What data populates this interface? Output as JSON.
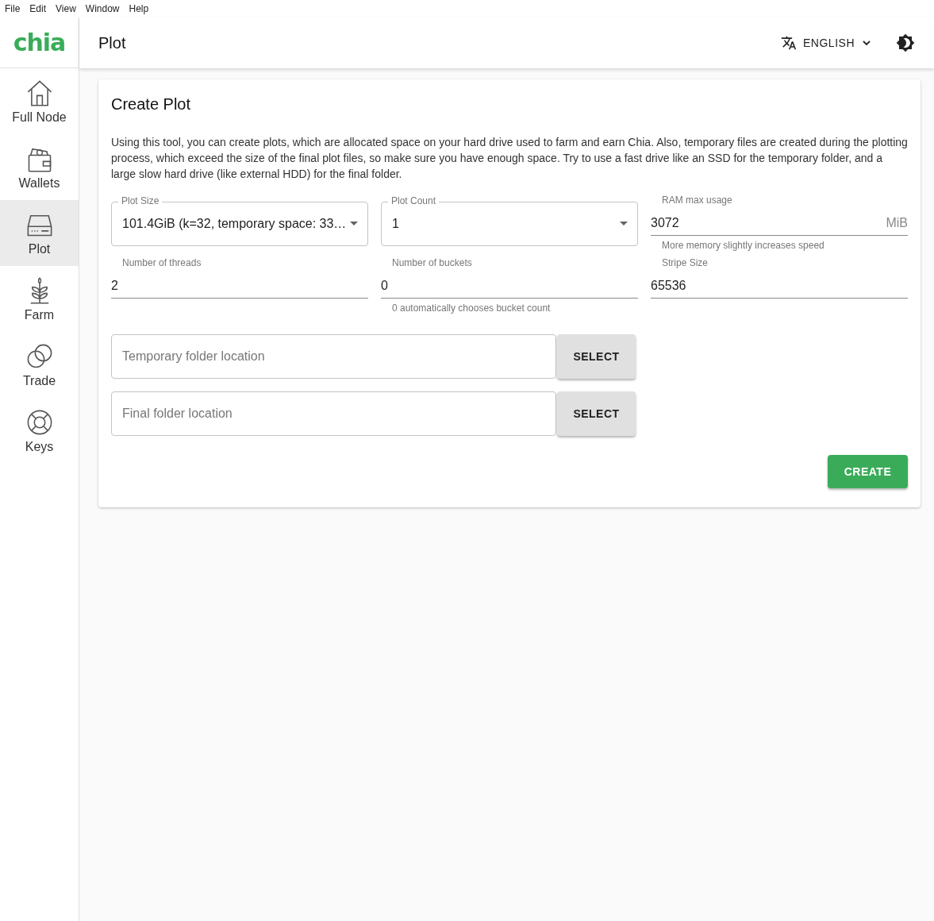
{
  "menu_bar": [
    "File",
    "Edit",
    "View",
    "Window",
    "Help"
  ],
  "logo": "chia",
  "header": {
    "title": "Plot",
    "language": "ENGLISH"
  },
  "sidebar": {
    "items": [
      {
        "label": "Full Node",
        "selected": false
      },
      {
        "label": "Wallets",
        "selected": false
      },
      {
        "label": "Plot",
        "selected": true
      },
      {
        "label": "Farm",
        "selected": false
      },
      {
        "label": "Trade",
        "selected": false
      },
      {
        "label": "Keys",
        "selected": false
      }
    ]
  },
  "card": {
    "title": "Create Plot",
    "description": "Using this tool, you can create plots, which are allocated space on your hard drive used to farm and earn Chia. Also, temporary files are created during the plotting process, which exceed the size of the final plot files, so make sure you have enough space. Try to use a fast drive like an SSD for the temporary folder, and a large slow hard drive (like external HDD) for the final folder.",
    "fields": [
      {
        "kind": "select",
        "label": "Plot Size",
        "value": "101.4GiB (k=32, temporary space: 33…"
      },
      {
        "kind": "select",
        "label": "Plot Count",
        "value": "1"
      },
      {
        "kind": "text",
        "label": "RAM max usage",
        "value": "3072",
        "suffix": "MiB",
        "helper": "More memory slightly increases speed"
      },
      {
        "kind": "text",
        "label": "Number of threads",
        "value": "2"
      },
      {
        "kind": "text",
        "label": "Number of buckets",
        "value": "0",
        "helper": "0 automatically chooses bucket count"
      },
      {
        "kind": "text",
        "label": "Stripe Size",
        "value": "65536"
      }
    ],
    "folders": [
      {
        "placeholder": "Temporary folder location",
        "button": "SELECT"
      },
      {
        "placeholder": "Final folder location",
        "button": "SELECT"
      }
    ],
    "create_button": "CREATE"
  }
}
